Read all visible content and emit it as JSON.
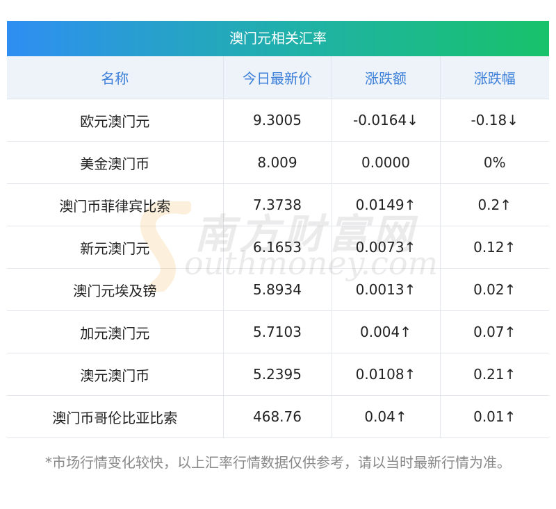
{
  "title": "澳门元相关汇率",
  "headers": [
    "名称",
    "今日最新价",
    "涨跌额",
    "涨跌幅"
  ],
  "rows": [
    {
      "name": "欧元澳门元",
      "price": "9.3005",
      "change": "-0.0164↓",
      "pct": "-0.18↓",
      "trend": "down"
    },
    {
      "name": "美金澳门币",
      "price": "8.009",
      "change": "0.0000",
      "pct": "0%",
      "trend": "flat"
    },
    {
      "name": "澳门币菲律宾比索",
      "price": "7.3738",
      "change": "0.0149↑",
      "pct": "0.2↑",
      "trend": "up"
    },
    {
      "name": "新元澳门元",
      "price": "6.1653",
      "change": "0.0073↑",
      "pct": "0.12↑",
      "trend": "up"
    },
    {
      "name": "澳门元埃及镑",
      "price": "5.8934",
      "change": "0.0013↑",
      "pct": "0.02↑",
      "trend": "up"
    },
    {
      "name": "加元澳门元",
      "price": "5.7103",
      "change": "0.004↑",
      "pct": "0.07↑",
      "trend": "up"
    },
    {
      "name": "澳元澳门币",
      "price": "5.2395",
      "change": "0.0108↑",
      "pct": "0.21↑",
      "trend": "up"
    },
    {
      "name": "澳门币哥伦比亚比索",
      "price": "468.76",
      "change": "0.04↑",
      "pct": "0.01↑",
      "trend": "up"
    }
  ],
  "watermark": {
    "cn": "南方财富网",
    "en": "outhmoney.com"
  },
  "footnote": "*市场行情变化较快，以上汇率行情数据仅供参考，请以当时最新行情为准。",
  "colors": {
    "up": "#e8141b",
    "down": "#2a8a2a",
    "header_text": "#3b7fd9",
    "header_bg": "#eef3fa"
  }
}
